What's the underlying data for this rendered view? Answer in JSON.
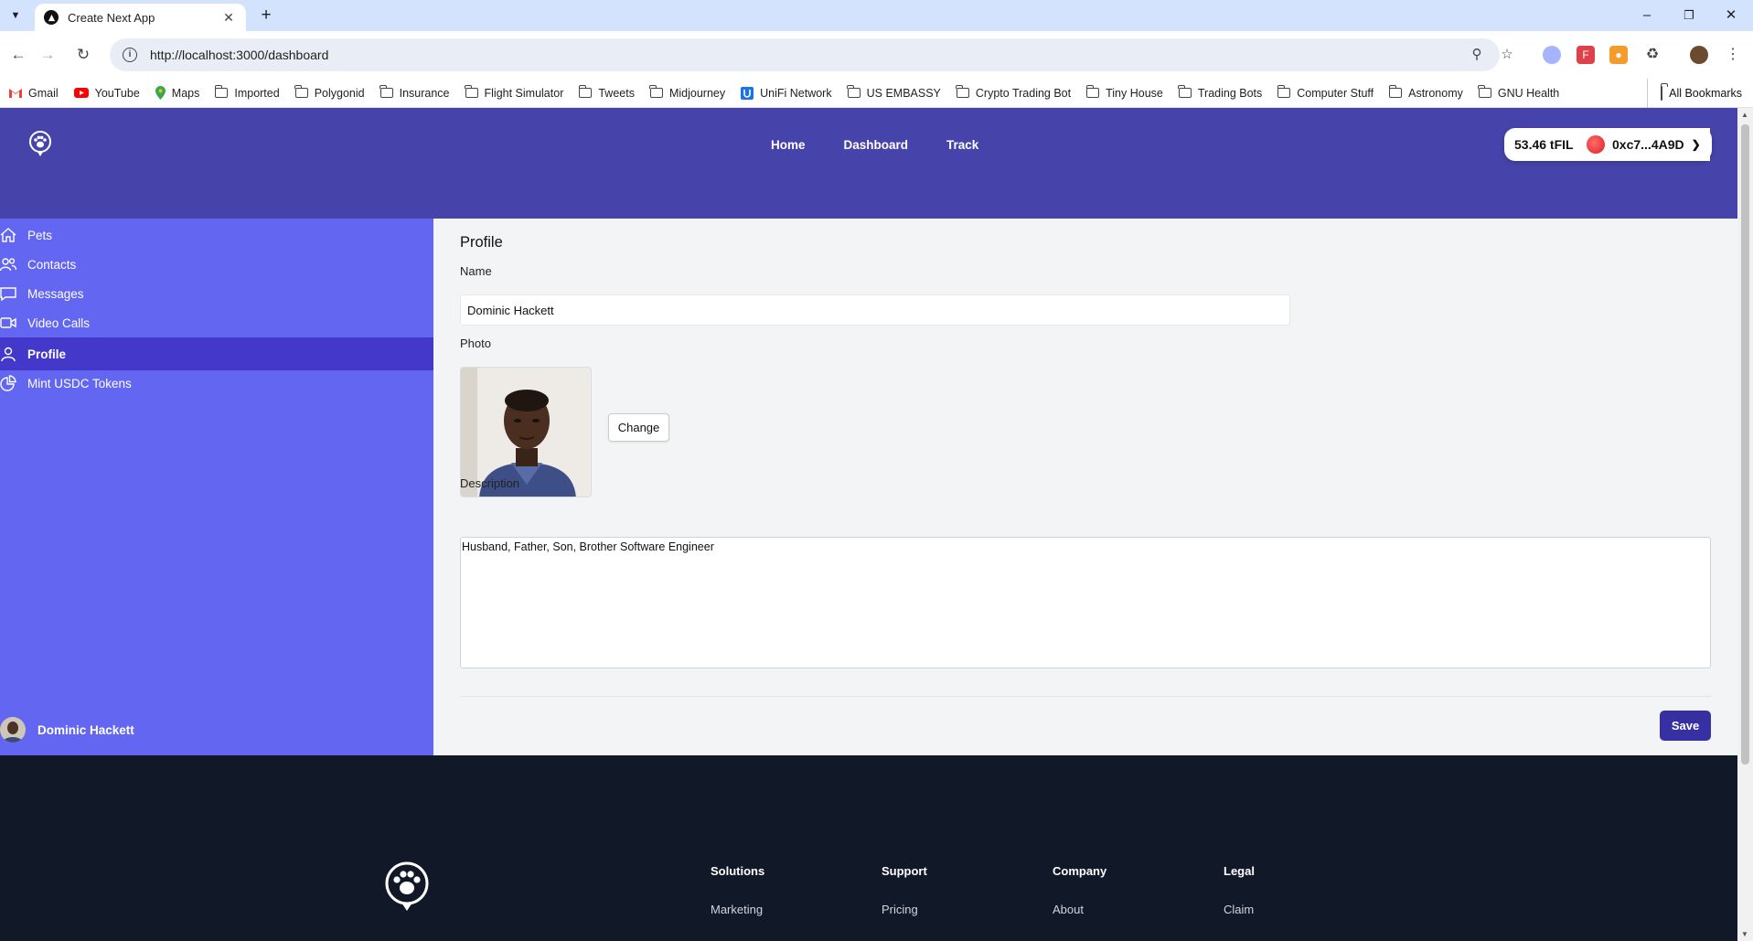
{
  "browser": {
    "tab_title": "Create Next App",
    "url": "http://localhost:3000/dashboard",
    "bookmarks": [
      {
        "label": "Gmail",
        "icon": "gmail-icon"
      },
      {
        "label": "YouTube",
        "icon": "youtube-icon"
      },
      {
        "label": "Maps",
        "icon": "maps-icon"
      },
      {
        "label": "Imported",
        "icon": "folder-icon"
      },
      {
        "label": "Polygonid",
        "icon": "folder-icon"
      },
      {
        "label": "Insurance",
        "icon": "folder-icon"
      },
      {
        "label": "Flight Simulator",
        "icon": "folder-icon"
      },
      {
        "label": "Tweets",
        "icon": "folder-icon"
      },
      {
        "label": "Midjourney",
        "icon": "folder-icon"
      },
      {
        "label": "UniFi Network",
        "icon": "unifi-icon"
      },
      {
        "label": "US EMBASSY",
        "icon": "folder-icon"
      },
      {
        "label": "Crypto Trading Bot",
        "icon": "folder-icon"
      },
      {
        "label": "Tiny House",
        "icon": "folder-icon"
      },
      {
        "label": "Trading Bots",
        "icon": "folder-icon"
      },
      {
        "label": "Computer Stuff",
        "icon": "folder-icon"
      },
      {
        "label": "Astronomy",
        "icon": "folder-icon"
      },
      {
        "label": "GNU Health",
        "icon": "folder-icon"
      }
    ],
    "all_bookmarks": "All Bookmarks"
  },
  "header": {
    "nav": [
      "Home",
      "Dashboard",
      "Track"
    ],
    "balance": "53.46 tFIL",
    "account": "0xc7...4A9D"
  },
  "sidebar": {
    "items": [
      {
        "label": "Pets",
        "icon": "home-icon",
        "active": false
      },
      {
        "label": "Contacts",
        "icon": "users-icon",
        "active": false
      },
      {
        "label": "Messages",
        "icon": "chat-icon",
        "active": false
      },
      {
        "label": "Video Calls",
        "icon": "video-icon",
        "active": false
      },
      {
        "label": "Profile",
        "icon": "user-icon",
        "active": true
      },
      {
        "label": "Mint USDC Tokens",
        "icon": "pie-chart-icon",
        "active": false
      }
    ],
    "user_name": "Dominic Hackett"
  },
  "profile": {
    "title": "Profile",
    "name_label": "Name",
    "name_value": "Dominic Hackett",
    "photo_label": "Photo",
    "change_label": "Change",
    "description_label": "Description",
    "description_value": "Husband, Father, Son, Brother Software Engineer",
    "save_label": "Save"
  },
  "footer": {
    "columns": [
      {
        "heading": "Solutions",
        "first_link": "Marketing"
      },
      {
        "heading": "Support",
        "first_link": "Pricing"
      },
      {
        "heading": "Company",
        "first_link": "About"
      },
      {
        "heading": "Legal",
        "first_link": "Claim"
      }
    ]
  },
  "colors": {
    "header": "#4644aa",
    "sidebar": "#6366f1",
    "sidebar_active": "#4338ca",
    "save_button": "#3730a3",
    "footer": "#111827"
  }
}
